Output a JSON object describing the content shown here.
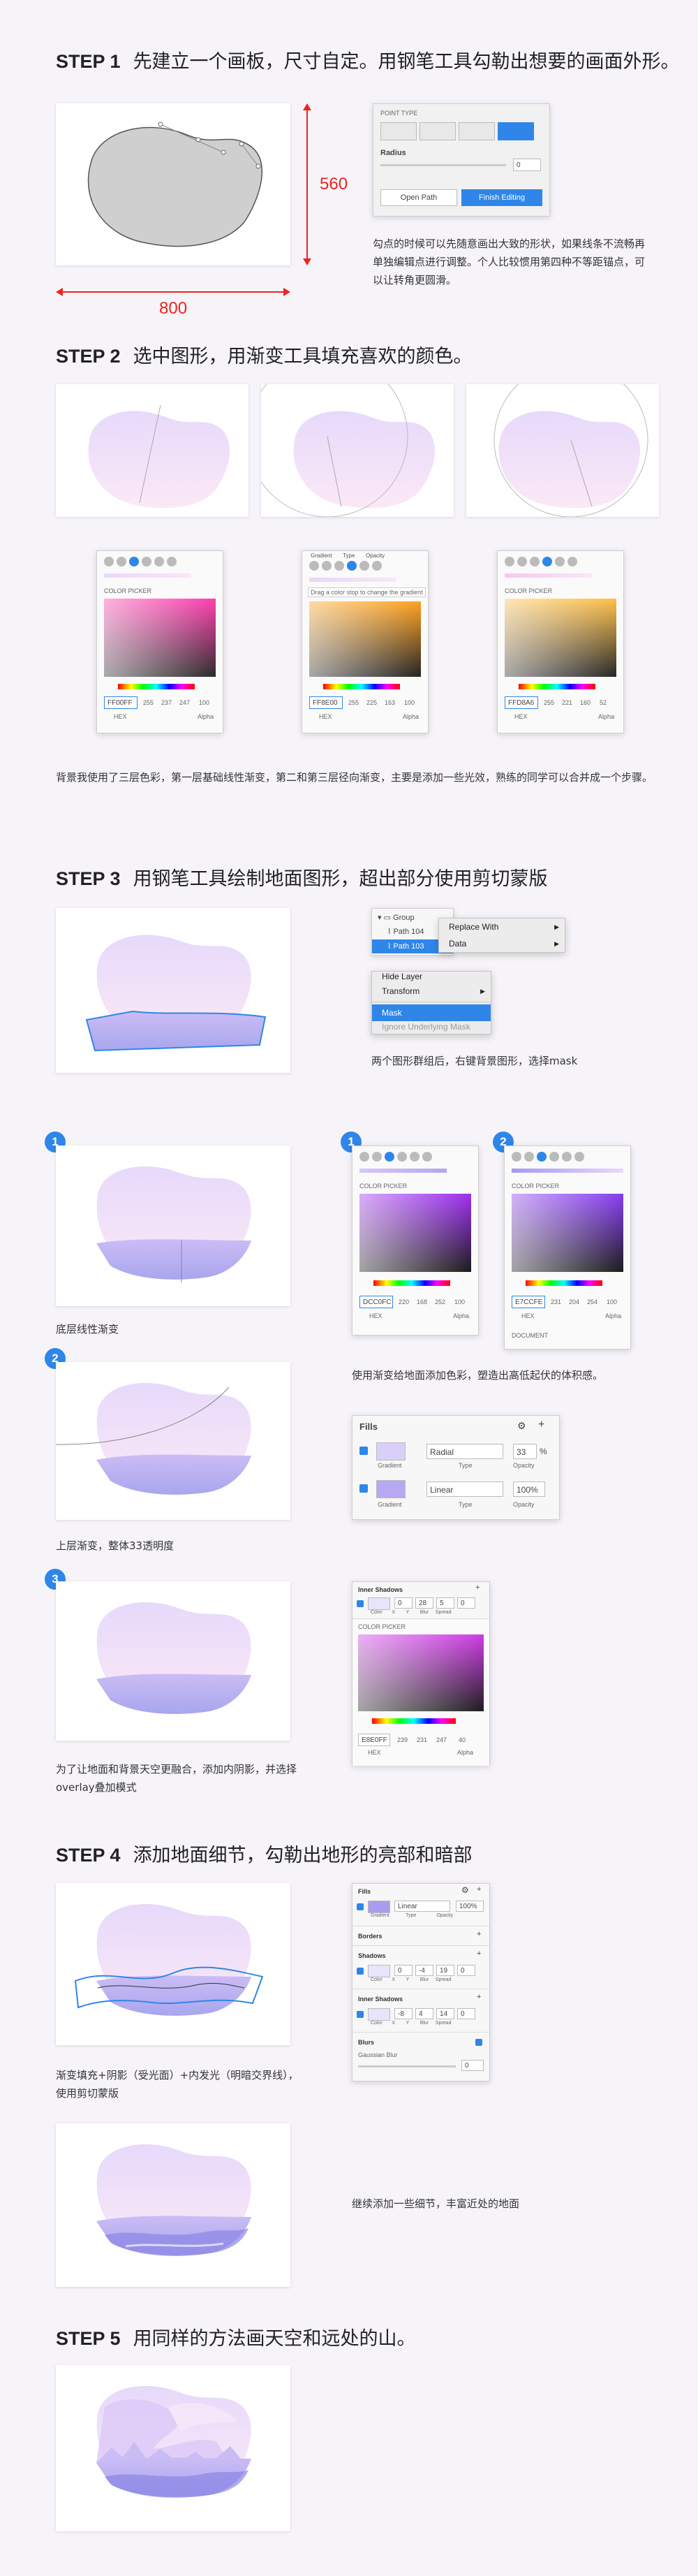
{
  "step1": {
    "num": "STEP 1",
    "title": "先建立一个画板，尺寸自定。用钢笔工具勾勒出想要的画面外形。",
    "height_label": "560",
    "width_label": "800",
    "panel": {
      "header": "POINT TYPE",
      "radius_label": "Radius",
      "radius_value": "0",
      "open_path": "Open Path",
      "finish_editing": "Finish Editing"
    },
    "caption": "勾点的时候可以先随意画出大致的形状，如果线条不流畅再单独编辑点进行调整。个人比较惯用第四种不等距锚点，可以让转角更圆滑。"
  },
  "step2": {
    "num": "STEP 2",
    "title": "选中图形，用渐变工具填充喜欢的颜色。",
    "pickers": [
      {
        "label": "COLOR PICKER",
        "hex": "FF00FF",
        "r": "255",
        "g": "237",
        "b": "247",
        "a": "100"
      },
      {
        "label": "COLOR PICKER",
        "hex": "FF8E00",
        "r": "255",
        "g": "225",
        "b": "163",
        "a": "100",
        "tip": "Drag a color stop to change the gradient",
        "tabs": [
          "Gradient",
          "Type",
          "Opacity"
        ]
      },
      {
        "label": "COLOR PICKER",
        "hex": "FFD8A6",
        "r": "255",
        "g": "221",
        "b": "160",
        "a": "52"
      }
    ],
    "hex_label": "HEX",
    "alpha_label": "Alpha",
    "caption": "背景我使用了三层色彩，第一层基础线性渐变，第二和第三层径向渐变，主要是添加一些光效，熟练的同学可以合并成一个步骤。"
  },
  "step3": {
    "num": "STEP 3",
    "title": "用钢笔工具绘制地面图形，超出部分使用剪切蒙版",
    "layers": {
      "group": "Group",
      "path104": "Path 104",
      "path103": "Path 103"
    },
    "menu1": [
      "Replace With",
      "Data"
    ],
    "menu2": [
      "Hide Layer",
      "Transform",
      "Mask",
      "Ignore Underlying Mask"
    ],
    "caption_right": "两个图形群组后，右键背景图形，选择mask",
    "caption_1": "底层线性渐变",
    "caption_mid": "使用渐变给地面添加色彩，塑造出高低起伏的体积感。",
    "caption_2": "上层渐变，整体33透明度",
    "caption_3": "为了让地面和背景天空更融合，添加内阴影，并选择overlay叠加模式",
    "pickerA": {
      "label": "COLOR PICKER",
      "hex": "DCC0FC",
      "r": "220",
      "g": "168",
      "b": "252",
      "a": "100"
    },
    "pickerB": {
      "label": "COLOR PICKER",
      "hex": "E7CCFE",
      "r": "231",
      "g": "204",
      "b": "254",
      "a": "100",
      "footer": "DOCUMENT"
    },
    "fills": {
      "title": "Fills",
      "row1": {
        "type": "Radial",
        "opacity": "33",
        "pct": "%"
      },
      "row2": {
        "type": "Linear",
        "opacity": "100%"
      },
      "labels": [
        "Gradient",
        "Type",
        "Opacity"
      ]
    },
    "inner_shadows": {
      "title": "Inner Shadows",
      "values": [
        "0",
        "28",
        "5",
        "0"
      ],
      "labels": [
        "Color",
        "X",
        "Y",
        "Blur",
        "Spread"
      ],
      "picker": {
        "label": "COLOR PICKER",
        "hex": "E8E0FF",
        "r": "239",
        "g": "231",
        "b": "247",
        "a": "40"
      }
    },
    "badges": [
      "1",
      "2",
      "3"
    ]
  },
  "step4": {
    "num": "STEP 4",
    "title": "添加地面细节，勾勒出地形的亮部和暗部",
    "panel": {
      "fills": "Fills",
      "fill_type": "Linear",
      "fill_opacity": "100%",
      "borders": "Borders",
      "shadows": "Shadows",
      "shadow_vals": [
        "0",
        "-4",
        "19",
        "0"
      ],
      "inner_shadows": "Inner Shadows",
      "inner_vals": [
        "-8",
        "4",
        "14",
        "0"
      ],
      "blurs": "Blurs",
      "blur_type": "Gaussian Blur",
      "blur_val": "0",
      "labels": [
        "Color",
        "X",
        "Y",
        "Blur",
        "Spread"
      ],
      "fill_labels": [
        "Gradient",
        "Type",
        "Opacity"
      ]
    },
    "caption_1": "渐变填充+阴影（受光面）+内发光（明暗交界线），使用剪切蒙版",
    "caption_2": "继续添加一些细节，丰富近处的地面"
  },
  "step5": {
    "num": "STEP 5",
    "title": "用同样的方法画天空和远处的山。"
  },
  "colors": {
    "accent": "#2f86e8",
    "red": "#e22222",
    "sky_pink": "#f3e2fb",
    "ground_purple": "#a9a3f0"
  }
}
